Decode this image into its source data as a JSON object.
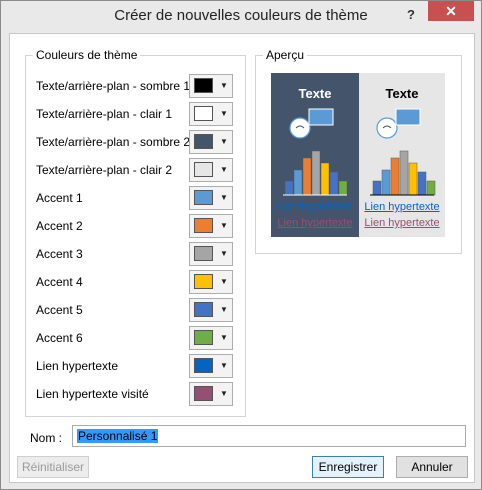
{
  "dialog": {
    "title": "Créer de nouvelles couleurs de thème",
    "help": "?",
    "close": "✕"
  },
  "theme_colors": {
    "legend": "Couleurs de thème",
    "items": [
      {
        "label": "Texte/arrière-plan - sombre 1",
        "color": "#000000"
      },
      {
        "label": "Texte/arrière-plan - clair 1",
        "color": "#ffffff"
      },
      {
        "label": "Texte/arrière-plan - sombre 2",
        "color": "#44546a"
      },
      {
        "label": "Texte/arrière-plan - clair 2",
        "color": "#e7e6e6"
      },
      {
        "label": "Accent 1",
        "color": "#5b9bd5"
      },
      {
        "label": "Accent 2",
        "color": "#ed7d31"
      },
      {
        "label": "Accent 3",
        "color": "#a5a5a5"
      },
      {
        "label": "Accent 4",
        "color": "#ffc000"
      },
      {
        "label": "Accent 5",
        "color": "#4472c4"
      },
      {
        "label": "Accent 6",
        "color": "#70ad47"
      },
      {
        "label": "Lien hypertexte",
        "color": "#0563c1"
      },
      {
        "label": "Lien hypertexte visité",
        "color": "#954f72"
      }
    ],
    "dropdown_icon": "chevron-down-icon"
  },
  "preview": {
    "legend": "Aperçu",
    "dark_panel": {
      "text": "Texte",
      "link": "Lien hypertexte",
      "visited_link": "Lien hypertexte"
    },
    "light_panel": {
      "text": "Texte",
      "link": "Lien hypertexte",
      "visited_link": "Lien hypertexte"
    },
    "chart_bar_levels": [
      0.3,
      0.55,
      0.8,
      0.95,
      0.7,
      0.5,
      0.3
    ]
  },
  "name_field": {
    "label": "Nom :",
    "value": "Personnalisé 1"
  },
  "buttons": {
    "reset": "Réinitialiser",
    "save": "Enregistrer",
    "cancel": "Annuler"
  }
}
